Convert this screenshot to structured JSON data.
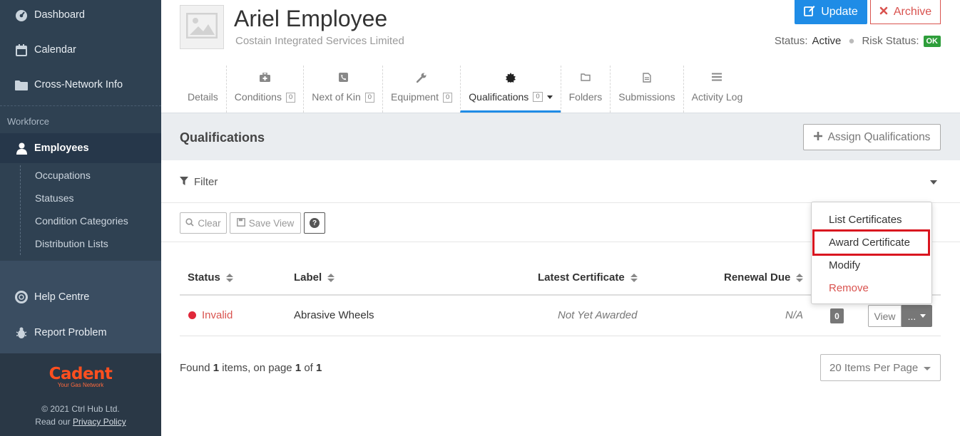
{
  "sidebar": {
    "items": [
      {
        "label": "Dashboard",
        "icon": "dashboard-icon"
      },
      {
        "label": "Calendar",
        "icon": "calendar-icon"
      },
      {
        "label": "Cross-Network Info",
        "icon": "folder-icon"
      }
    ],
    "section_label": "Workforce",
    "employees_label": "Employees",
    "sub_items": [
      "Occupations",
      "Statuses",
      "Condition Categories",
      "Distribution Lists"
    ],
    "help_label": "Help Centre",
    "report_label": "Report Problem",
    "brand_name": "Cadent",
    "brand_tagline": "Your Gas Network",
    "copyright": "© 2021 Ctrl Hub Ltd.",
    "read_our": "Read our",
    "privacy_link": "Privacy Policy"
  },
  "header": {
    "name": "Ariel Employee",
    "company": "Costain Integrated Services Limited",
    "update_label": "Update",
    "archive_label": "Archive",
    "status_label": "Status:",
    "status_value": "Active",
    "risk_label": "Risk Status:",
    "risk_value": "OK"
  },
  "tabs": [
    {
      "label": "Details"
    },
    {
      "label": "Conditions",
      "count": "0"
    },
    {
      "label": "Next of Kin",
      "count": "0"
    },
    {
      "label": "Equipment",
      "count": "0"
    },
    {
      "label": "Qualifications",
      "count": "0",
      "active": true
    },
    {
      "label": "Folders"
    },
    {
      "label": "Submissions"
    },
    {
      "label": "Activity Log"
    }
  ],
  "section": {
    "title": "Qualifications",
    "assign_label": "Assign Qualifications",
    "filter_label": "Filter",
    "clear_label": "Clear",
    "save_view_label": "Save View",
    "help_glyph": "?"
  },
  "table": {
    "columns": [
      "Status",
      "Label",
      "Latest Certificate",
      "Renewal Due"
    ],
    "rows": [
      {
        "status": "Invalid",
        "label": "Abrasive Wheels",
        "latest_certificate": "Not Yet Awarded",
        "renewal_due": "N/A",
        "count": "0",
        "view_label": "View",
        "more_label": "..."
      }
    ]
  },
  "footer": {
    "found_prefix": "Found",
    "found_count": "1",
    "found_mid": "items, on page",
    "page": "1",
    "of": "of",
    "pages": "1",
    "per_page": "20 Items Per Page"
  },
  "menu": {
    "items": [
      "List Certificates",
      "Award Certificate",
      "Modify",
      "Remove"
    ]
  },
  "colors": {
    "sidebar_bg": "#2f4152",
    "primary": "#1f8ce6",
    "danger": "#d9534f",
    "ok": "#2e9e3b",
    "brand": "#ff4f1f"
  }
}
